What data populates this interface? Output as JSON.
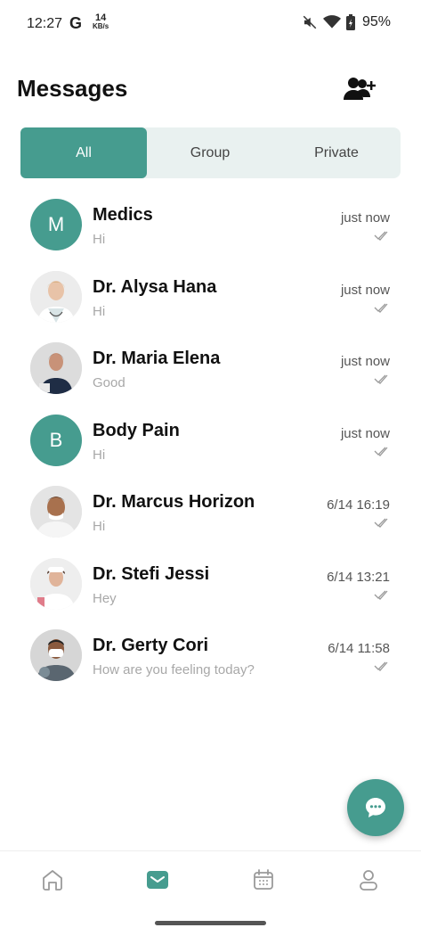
{
  "status_bar": {
    "time": "12:27",
    "carrier_icon": "G",
    "speed_value": "14",
    "speed_unit": "KB/s",
    "battery": "95%"
  },
  "header": {
    "title": "Messages",
    "add_contact_icon": "person-add-icon"
  },
  "tabs": [
    {
      "label": "All",
      "active": true
    },
    {
      "label": "Group",
      "active": false
    },
    {
      "label": "Private",
      "active": false
    }
  ],
  "conversations": [
    {
      "name": "Medics",
      "preview": "Hi",
      "time": "just now",
      "avatar_letter": "M"
    },
    {
      "name": "Dr. Alysa Hana",
      "preview": "Hi",
      "time": "just now"
    },
    {
      "name": "Dr. Maria Elena",
      "preview": "Good",
      "time": "just now"
    },
    {
      "name": "Body Pain",
      "preview": "Hi",
      "time": "just now",
      "avatar_letter": "B"
    },
    {
      "name": "Dr. Marcus Horizon",
      "preview": "Hi",
      "time": "6/14 16:19"
    },
    {
      "name": "Dr. Stefi Jessi",
      "preview": "Hey",
      "time": "6/14 13:21"
    },
    {
      "name": "Dr. Gerty Cori",
      "preview": "How are you feeling today?",
      "time": "6/14 11:58"
    }
  ],
  "colors": {
    "accent": "#469c8f",
    "tab_background": "#e9f1f0",
    "preview_text": "#a8a8a8"
  },
  "fab_icon": "chat-bubble-icon",
  "bottom_nav": [
    {
      "icon": "home-icon",
      "active": false
    },
    {
      "icon": "mail-icon",
      "active": true
    },
    {
      "icon": "calendar-icon",
      "active": false
    },
    {
      "icon": "profile-icon",
      "active": false
    }
  ]
}
